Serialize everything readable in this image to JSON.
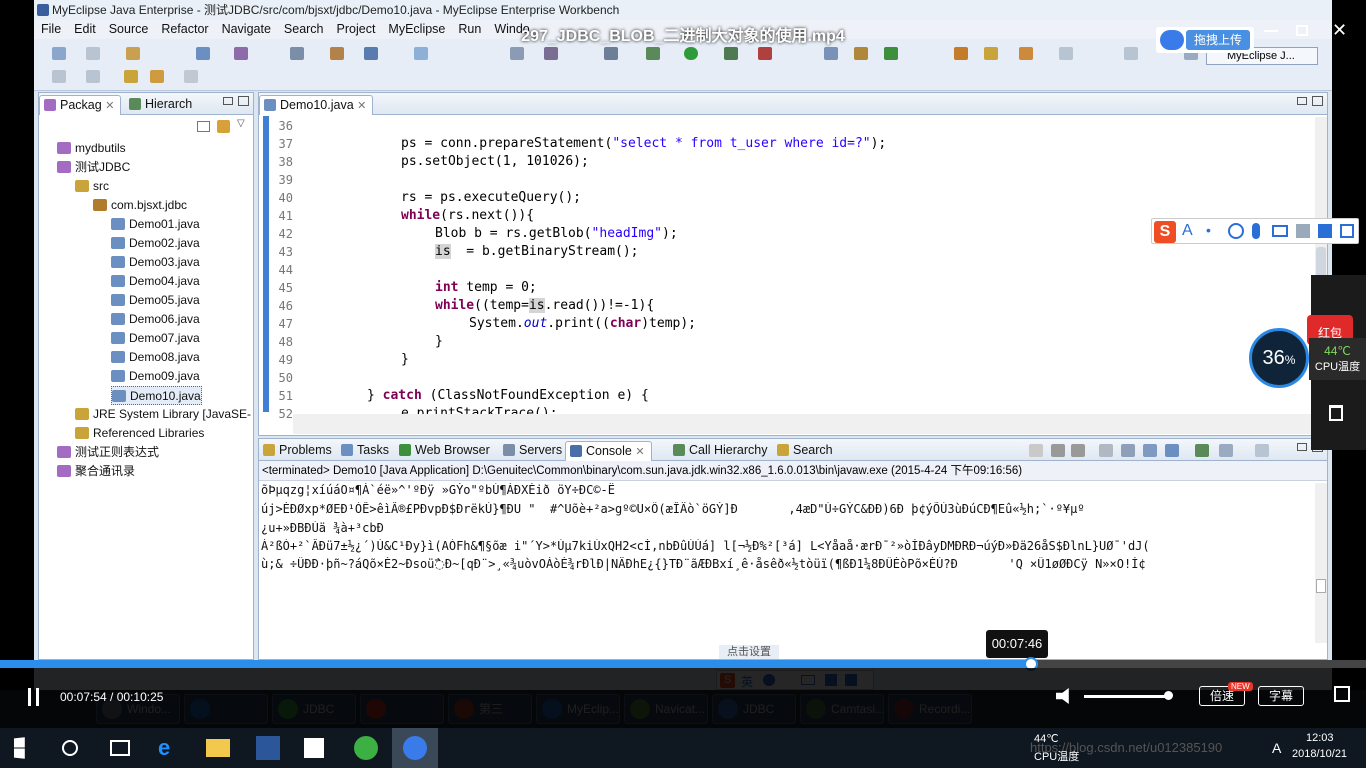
{
  "video": {
    "title": "297_JDBC_BLOB_二进制大对象的使用.mp4",
    "upload_label": "拖拽上传",
    "time_tooltip": "00:07:46",
    "time_display": "00:07:54 / 00:10:25",
    "progress_fraction": 0.755,
    "speed_label": "倍速",
    "speed_badge": "NEW",
    "subtitle_label": "字幕",
    "hint_label": "点击设置"
  },
  "ide": {
    "window_title": "MyEclipse Java Enterprise - 测试JDBC/src/com/bjsxt/jdbc/Demo10.java - MyEclipse Enterprise Workbench",
    "menu": [
      "File",
      "Edit",
      "Source",
      "Refactor",
      "Navigate",
      "Search",
      "Project",
      "MyEclipse",
      "Run",
      "Windo"
    ],
    "perspective": "MyEclipse J...",
    "package_tabs": [
      "Packag",
      "Hierarch"
    ],
    "tree": [
      {
        "label": "mydbutils",
        "depth": 1
      },
      {
        "label": "测试JDBC",
        "depth": 1
      },
      {
        "label": "src",
        "depth": 2
      },
      {
        "label": "com.bjsxt.jdbc",
        "depth": 3
      },
      {
        "label": "Demo01.java",
        "depth": 4
      },
      {
        "label": "Demo02.java",
        "depth": 4
      },
      {
        "label": "Demo03.java",
        "depth": 4
      },
      {
        "label": "Demo04.java",
        "depth": 4
      },
      {
        "label": "Demo05.java",
        "depth": 4
      },
      {
        "label": "Demo06.java",
        "depth": 4
      },
      {
        "label": "Demo07.java",
        "depth": 4
      },
      {
        "label": "Demo08.java",
        "depth": 4
      },
      {
        "label": "Demo09.java",
        "depth": 4
      },
      {
        "label": "Demo10.java",
        "depth": 4
      },
      {
        "label": "JRE System Library [JavaSE-",
        "depth": 2
      },
      {
        "label": "Referenced Libraries",
        "depth": 2
      },
      {
        "label": "测试正则表达式",
        "depth": 1
      },
      {
        "label": "聚合通讯录",
        "depth": 1
      }
    ],
    "editor_tab": "Demo10.java",
    "line_numbers": [
      "36",
      "37",
      "38",
      "39",
      "40",
      "41",
      "42",
      "43",
      "44",
      "45",
      "46",
      "47",
      "48",
      "49",
      "50",
      "51",
      "52"
    ],
    "code": {
      "l37a": "ps = conn.prepareStatement(",
      "l37s": "\"select * from t_user where id=?\"",
      "l37b": ");",
      "l38": "ps.setObject(1, 101026);",
      "l40": "rs = ps.executeQuery();",
      "l41k": "while",
      "l41": "(rs.next()){",
      "l42a": "Blob b = rs.getBlob(",
      "l42s": "\"headImg\"",
      "l42b": ");",
      "l43a": "is",
      "l43b": "  = b.getBinaryStream();",
      "l45k": "int",
      "l45": " temp = 0;",
      "l46k": "while",
      "l46a": "((temp=",
      "l46h": "is",
      "l46b": ".read())!=-1){",
      "l47a": "System.",
      "l47i": "out",
      "l47b": ".print((",
      "l47k": "char",
      "l47c": ")temp);",
      "l48": "}",
      "l49": "}",
      "l51a": "} ",
      "l51k": "catch",
      "l51b": " (ClassNotFoundException e) {",
      "l52": "e.printStackTrace();"
    },
    "console_tabs": [
      "Problems",
      "Tasks",
      "Web Browser",
      "Servers",
      "Console",
      "Call Hierarchy",
      "Search"
    ],
    "console_header": "<terminated> Demo10 [Java Application] D:\\Genuitec\\Common\\binary\\com.sun.java.jdk.win32.x86_1.6.0.013\\bin\\javaw.exe (2015-4-24 下午09:16:56)",
    "console_lines": [
      "õÞµqzg¦xíúáO¤¶Á`éë»^'ºÐÿ »GÝo\"ºbÚ¶ÁÐXÈið öY÷ÐC©-Ë",
      "új>ÈÐØxp*ØEÐ¹ÒÊ>êìÂ®£PÐvpÐ$ÐrëkÙ}¶ÐU \"  #^Uõè+²a>gº©U×Ô(æÎÄò`öGÝ]Ð       ,4æD\"Ú÷GÝC&ÐÐ)6Ð þ¢ýÕÙ3ùÐúCÐ¶Eû«½h;`·º¥µº",
      "¿u+»ÐBÐÚä ¾à+³cbÐ",
      "À²ßÒ+²`ÂÐü7±½¿´)Ú&C¹Ðy}ì(AÒFh&¶§õæ i\"´Y>*Ùµ7kiÚxQH2<cÌ,nbÐûÚÚá] l[¬½Ð%²[³á] L<Yåaå·ærÐ¯²»òÍÐâyDMÐRÐ¬úýÐ»Ðä26åS$ÐlnL}UØ¯'dJ(",
      "ù;& ÷ÛÐÐ·þñ~?áQõ×È2~Ðsoü߯Ð~[qÐ¨>¸«¾uòvOÁòÉ¾rÐlÐ|NÄÐhE¿{}TÐ¨ãÆÐBxí¸ê·åsêð«½tòüï(¶ßÐ1¼8ÐÛÉòPõ×ÈÙ?Ð       'Q ×Û1øØÐCÿ N»×O!Í¢"
    ]
  },
  "overlay": {
    "cpu_percent": "36",
    "cpu_percent_sign": "%",
    "cpu_temp": "44℃",
    "cpu_temp_label": "CPU温度",
    "red_packet": "红包",
    "ime_label": "英"
  },
  "taskbar7": [
    "Windo...",
    "",
    "JDBC读...",
    "",
    "第三季.p...",
    "MyEclip...",
    "Navicat...",
    "JDBC规...",
    "Camtasi...",
    "Recordi..."
  ],
  "taskbar10": {
    "temp": "44℃",
    "temp_label": "CPU温度",
    "time": "12:03",
    "date": "2018/10/21",
    "watermark": "https://blog.csdn.net/u012385190",
    "ime": "A"
  }
}
